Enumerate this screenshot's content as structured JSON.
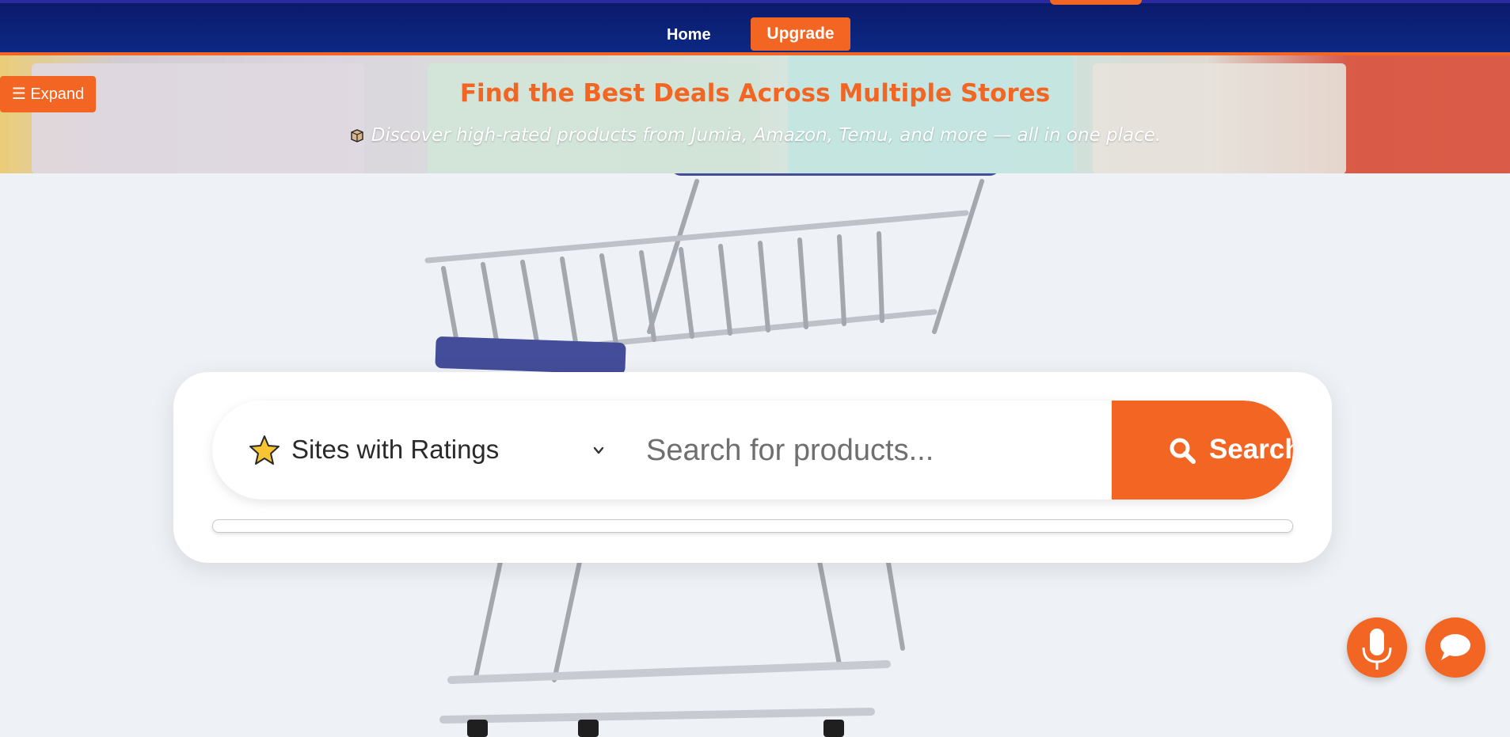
{
  "nav": {
    "home_label": "Home",
    "upgrade_label": "Upgrade"
  },
  "hero": {
    "expand_label": "☰ Expand",
    "title": "Find the Best Deals Across Multiple Stores",
    "subtitle": "Discover high-rated products from Jumia, Amazon, Temu, and more — all in one place.",
    "subtitle_icon": "box-icon"
  },
  "search": {
    "site_filter_label": "Sites with Ratings",
    "site_filter_icon": "star-icon",
    "placeholder": "Search for products...",
    "value": "",
    "button_label": "Search",
    "button_icon": "search-icon"
  },
  "floating": {
    "voice_icon": "microphone-icon",
    "chat_icon": "chat-bubble-icon"
  },
  "colors": {
    "accent": "#f26522",
    "nav_bg": "#0c2a86",
    "page_bg": "#eef1f5"
  }
}
